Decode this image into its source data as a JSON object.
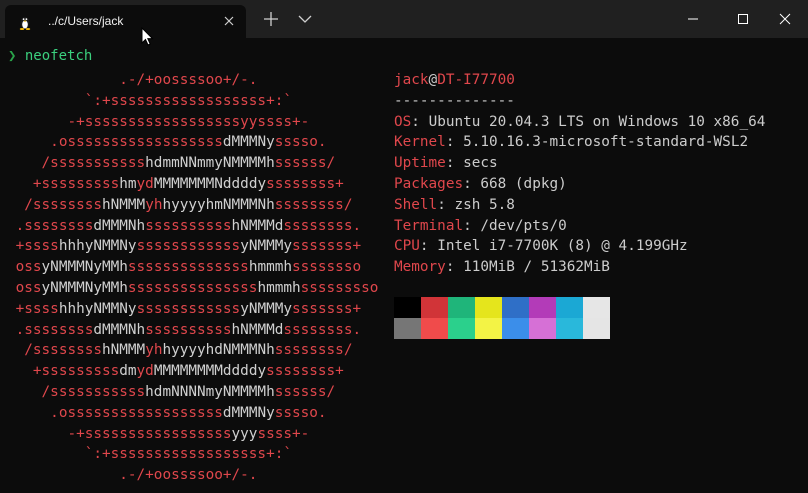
{
  "window": {
    "tab_title": "../c/Users/jack",
    "tab_icon": "linux-penguin-icon"
  },
  "terminal": {
    "prompt_symbol": "❯",
    "command": "neofetch",
    "ascii_art": [
      [
        {
          "t": "             .-/+oossssoo+/-.",
          "c": "r"
        }
      ],
      [
        {
          "t": "         `:+ssssssssssssssssss+:`",
          "c": "r"
        }
      ],
      [
        {
          "t": "       -+ssssssssssssssssssyyssss+-",
          "c": "r"
        }
      ],
      [
        {
          "t": "     .ossssssssssssssssss",
          "c": "r"
        },
        {
          "t": "dMMMNy",
          "c": "w"
        },
        {
          "t": "sssso.",
          "c": "r"
        }
      ],
      [
        {
          "t": "    /sssssssssss",
          "c": "r"
        },
        {
          "t": "hdmmNNmmyNMMMMh",
          "c": "w"
        },
        {
          "t": "ssssss/",
          "c": "r"
        }
      ],
      [
        {
          "t": "   +sssssssss",
          "c": "r"
        },
        {
          "t": "hm",
          "c": "w"
        },
        {
          "t": "yd",
          "c": "r"
        },
        {
          "t": "MMMMMMMNddddy",
          "c": "w"
        },
        {
          "t": "ssssssss+",
          "c": "r"
        }
      ],
      [
        {
          "t": "  /ssssssss",
          "c": "r"
        },
        {
          "t": "hNMMM",
          "c": "w"
        },
        {
          "t": "yh",
          "c": "r"
        },
        {
          "t": "hyyyyhmNMMMNh",
          "c": "w"
        },
        {
          "t": "ssssssss/",
          "c": "r"
        }
      ],
      [
        {
          "t": " .ssssssss",
          "c": "r"
        },
        {
          "t": "dMMMNh",
          "c": "w"
        },
        {
          "t": "ssssssssss",
          "c": "r"
        },
        {
          "t": "hNMMMd",
          "c": "w"
        },
        {
          "t": "ssssssss.",
          "c": "r"
        }
      ],
      [
        {
          "t": " +ssss",
          "c": "r"
        },
        {
          "t": "hhhyNMMNy",
          "c": "w"
        },
        {
          "t": "ssssssssssss",
          "c": "r"
        },
        {
          "t": "yNMMMy",
          "c": "w"
        },
        {
          "t": "sssssss+",
          "c": "r"
        }
      ],
      [
        {
          "t": " oss",
          "c": "r"
        },
        {
          "t": "yNMMMNyMMh",
          "c": "w"
        },
        {
          "t": "ssssssssssssss",
          "c": "r"
        },
        {
          "t": "hmmmh",
          "c": "w"
        },
        {
          "t": "ssssssso",
          "c": "r"
        }
      ],
      [
        {
          "t": " oss",
          "c": "r"
        },
        {
          "t": "yNMMMNyMMh",
          "c": "w"
        },
        {
          "t": "sssssssssssssss",
          "c": "r"
        },
        {
          "t": "hmmmh",
          "c": "w"
        },
        {
          "t": "sssssssso",
          "c": "r"
        }
      ],
      [
        {
          "t": " +ssss",
          "c": "r"
        },
        {
          "t": "hhhyNMMNy",
          "c": "w"
        },
        {
          "t": "ssssssssssss",
          "c": "r"
        },
        {
          "t": "yNMMMy",
          "c": "w"
        },
        {
          "t": "sssssss+",
          "c": "r"
        }
      ],
      [
        {
          "t": " .ssssssss",
          "c": "r"
        },
        {
          "t": "dMMMNh",
          "c": "w"
        },
        {
          "t": "ssssssssss",
          "c": "r"
        },
        {
          "t": "hNMMMd",
          "c": "w"
        },
        {
          "t": "ssssssss.",
          "c": "r"
        }
      ],
      [
        {
          "t": "  /ssssssss",
          "c": "r"
        },
        {
          "t": "hNMMM",
          "c": "w"
        },
        {
          "t": "yh",
          "c": "r"
        },
        {
          "t": "hyyyyhdNMMMNh",
          "c": "w"
        },
        {
          "t": "ssssssss/",
          "c": "r"
        }
      ],
      [
        {
          "t": "   +sssssssss",
          "c": "r"
        },
        {
          "t": "dm",
          "c": "w"
        },
        {
          "t": "yd",
          "c": "r"
        },
        {
          "t": "MMMMMMMMddddy",
          "c": "w"
        },
        {
          "t": "ssssssss+",
          "c": "r"
        }
      ],
      [
        {
          "t": "    /sssssssssss",
          "c": "r"
        },
        {
          "t": "hdmNNNNmyNMMMMh",
          "c": "w"
        },
        {
          "t": "ssssss/",
          "c": "r"
        }
      ],
      [
        {
          "t": "     .ossssssssssssssssss",
          "c": "r"
        },
        {
          "t": "dMMMNy",
          "c": "w"
        },
        {
          "t": "sssso.",
          "c": "r"
        }
      ],
      [
        {
          "t": "       -+sssssssssssssssss",
          "c": "r"
        },
        {
          "t": "yyy",
          "c": "w"
        },
        {
          "t": "ssss+-",
          "c": "r"
        }
      ],
      [
        {
          "t": "         `:+ssssssssssssssssss+:`",
          "c": "r"
        }
      ],
      [
        {
          "t": "             .-/+oossssoo+/-.",
          "c": "r"
        }
      ]
    ],
    "info": {
      "user": "jack",
      "at": "@",
      "host": "DT-I77700",
      "separator": "--------------",
      "fields": [
        {
          "key": "OS",
          "value": "Ubuntu 20.04.3 LTS on Windows 10 x86_64"
        },
        {
          "key": "Kernel",
          "value": "5.10.16.3-microsoft-standard-WSL2"
        },
        {
          "key": "Uptime",
          "value": "secs"
        },
        {
          "key": "Packages",
          "value": "668 (dpkg)"
        },
        {
          "key": "Shell",
          "value": "zsh 5.8"
        },
        {
          "key": "Terminal",
          "value": "/dev/pts/0"
        },
        {
          "key": "CPU",
          "value": "Intel i7-7700K (8) @ 4.199GHz"
        },
        {
          "key": "Memory",
          "value": "110MiB / 51362MiB"
        }
      ]
    },
    "palette": [
      "#0c0c0c",
      "#c50f1f",
      "#13a10e",
      "#c19c00",
      "#0037da",
      "#881798",
      "#3a96dd",
      "#cccccc",
      "#767676",
      "#e74856",
      "#16c60c",
      "#f9f1a5",
      "#3b78ff",
      "#b4009e",
      "#61d6d6",
      "#f2f2f2"
    ],
    "palette_display": [
      "#000000",
      "#d13438",
      "#1fb57a",
      "#e5e51c",
      "#2f6fc7",
      "#b33bb8",
      "#1ba8d4",
      "#e6e6e6",
      "#767676",
      "#f04b4b",
      "#2bd08c",
      "#f3f345",
      "#3b8eea",
      "#d670d6",
      "#29b8db",
      "#e5e5e5"
    ]
  }
}
